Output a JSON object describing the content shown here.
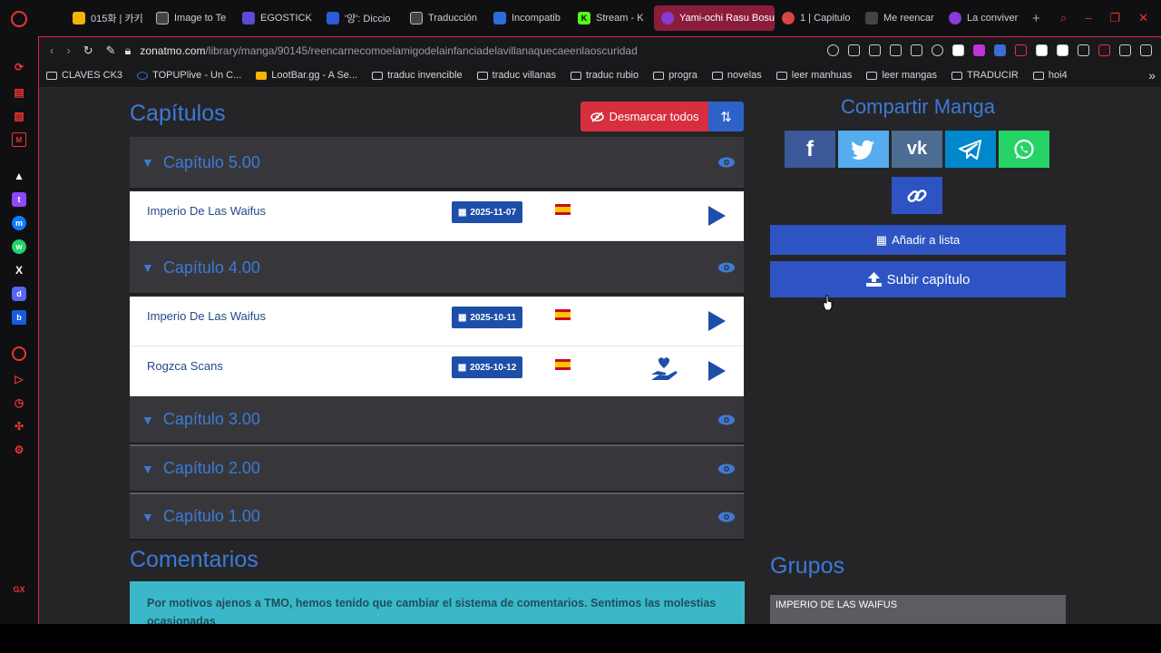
{
  "browser": {
    "tabs": [
      {
        "label": "015화 | 카키",
        "color": "#f5b400"
      },
      {
        "label": "Image to Te",
        "color": "#444"
      },
      {
        "label": "EGOSTICK",
        "color": "#5b4bd6"
      },
      {
        "label": "'양': Diccio",
        "color": "#2e5bd6"
      },
      {
        "label": "Traducción",
        "color": "#444"
      },
      {
        "label": "Incompatib",
        "color": "#2e6bd6"
      },
      {
        "label": "Stream - K",
        "color": "#53fc18"
      },
      {
        "label": "Yami-ochi Rasu Bosu",
        "color": "#8a3bd6"
      },
      {
        "label": "1 | Capitulo",
        "color": "#d64545"
      },
      {
        "label": "Me reencar",
        "color": "#444"
      },
      {
        "label": "La conviver",
        "color": "#8a3bd6"
      }
    ],
    "active_tab": 7,
    "new_tab_label": "+",
    "url_domain": "zonatmo.com",
    "url_path": "/library/manga/90145/reencarnecomoelamigodelainfanciadelavillanaquecaeenlaoscuridad",
    "bookmarks": [
      {
        "label": "CLAVES CK3",
        "icon": "folder"
      },
      {
        "label": "TOPUPlive - Un C...",
        "icon": "site"
      },
      {
        "label": "LootBar.gg - A Se...",
        "icon": "site"
      },
      {
        "label": "traduc invencible",
        "icon": "folder"
      },
      {
        "label": "traduc villanas",
        "icon": "folder"
      },
      {
        "label": "traduc rubio",
        "icon": "folder"
      },
      {
        "label": "progra",
        "icon": "folder"
      },
      {
        "label": "novelas",
        "icon": "folder"
      },
      {
        "label": "leer manhuas",
        "icon": "folder"
      },
      {
        "label": "leer mangas",
        "icon": "folder"
      },
      {
        "label": "TRADUCIR",
        "icon": "folder"
      },
      {
        "label": "hoi4",
        "icon": "folder"
      }
    ],
    "sidebar_gx_label": "GX"
  },
  "page": {
    "chapters_title": "Capítulos",
    "unmark_all_label": "Desmarcar todos",
    "chapters": [
      {
        "title": "Capítulo 5.00",
        "uploads": [
          {
            "group": "Imperio De Las Waifus",
            "date": "2025-11-07"
          }
        ]
      },
      {
        "title": "Capítulo 4.00",
        "uploads": [
          {
            "group": "Imperio De Las Waifus",
            "date": "2025-10-11"
          },
          {
            "group": "Rogzca Scans",
            "date": "2025-10-12"
          }
        ]
      },
      {
        "title": "Capítulo 3.00",
        "uploads": []
      },
      {
        "title": "Capítulo 2.00",
        "uploads": []
      },
      {
        "title": "Capítulo 1.00",
        "uploads": []
      }
    ],
    "comments_title": "Comentarios",
    "comments_notice": "Por motivos ajenos a TMO, hemos tenido que cambiar el sistema de comentarios. Sentimos las molestias ocasionadas",
    "share_title": "Compartir Manga",
    "share_buttons": [
      {
        "name": "facebook",
        "glyph": "f",
        "color": "#3b5998"
      },
      {
        "name": "twitter",
        "glyph": "t",
        "color": "#55acee"
      },
      {
        "name": "vk",
        "glyph": "vk",
        "color": "#4c6c91"
      },
      {
        "name": "telegram",
        "glyph": "tg",
        "color": "#0088cc"
      },
      {
        "name": "whatsapp",
        "glyph": "wa",
        "color": "#25d366"
      },
      {
        "name": "copy-link",
        "glyph": "link",
        "color": "#2d54c2"
      }
    ],
    "add_to_list_label": "Añadir a lista",
    "upload_chapter_label": "Subir capítulo",
    "groups_title": "Grupos",
    "group_card_name": "IMPERIO DE LAS WAIFUS"
  },
  "colors": {
    "accent": "#3d7ad6",
    "danger": "#d62f3f",
    "primary": "#2d54c2",
    "notice": "#3ab8c9"
  }
}
